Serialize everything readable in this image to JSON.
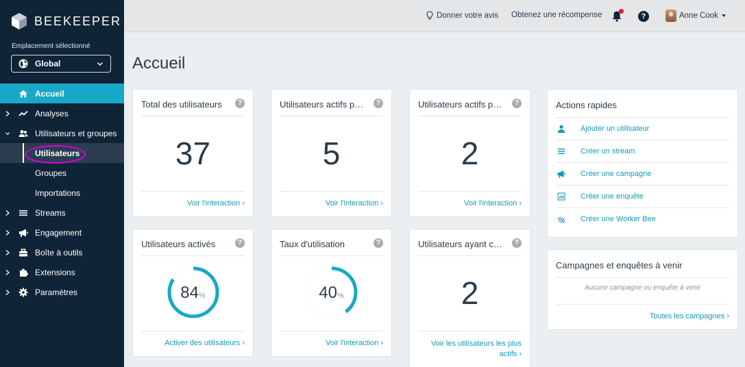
{
  "brand": {
    "name": "BEEKEEPER"
  },
  "location": {
    "label": "Emplacement sélectionné",
    "value": "Global"
  },
  "nav": {
    "home": "Accueil",
    "analytics": "Analyses",
    "users_groups": "Utilisateurs et groupes",
    "users": "Utilisateurs",
    "groups": "Groupes",
    "imports": "Importations",
    "streams": "Streams",
    "engagement": "Engagement",
    "toolbox": "Boîte à outils",
    "extensions": "Extensions",
    "settings": "Paramètres"
  },
  "topbar": {
    "feedback": "Donner votre avis",
    "reward": "Obtenez une récompense",
    "help": "?",
    "user": "Anne Cook"
  },
  "page": {
    "title": "Accueil"
  },
  "cards": {
    "total_users": {
      "title": "Total des utilisateurs",
      "value": "37",
      "link": "Voir l'interaction ›"
    },
    "active_users_1": {
      "title": "Utilisateurs actifs pa...",
      "value": "5",
      "link": "Voir l'interaction ›"
    },
    "active_users_2": {
      "title": "Utilisateurs actifs pa...",
      "value": "2",
      "link": "Voir l'interaction ›"
    },
    "activated": {
      "title": "Utilisateurs activés",
      "value": "84",
      "percent_sign": "%",
      "fraction": 0.84,
      "link": "Activer des utilisateurs ›"
    },
    "usage_rate": {
      "title": "Taux d'utilisation",
      "value": "40",
      "percent_sign": "%",
      "fraction": 0.4,
      "link": "Voir l'interaction ›"
    },
    "users_with": {
      "title": "Utilisateurs ayant co...",
      "value": "2",
      "link_line1": "Voir les utilisateurs les plus",
      "link_line2": "actifs ›"
    }
  },
  "quick_actions": {
    "title": "Actions rapides",
    "items": [
      {
        "label": "Ajouter un utilisateur",
        "icon": "user-icon"
      },
      {
        "label": "Créer un stream",
        "icon": "stream-icon"
      },
      {
        "label": "Créer une campagne",
        "icon": "megaphone-icon"
      },
      {
        "label": "Créer une enquête",
        "icon": "survey-icon"
      },
      {
        "label": "Créer une Worker Bee",
        "icon": "workerbee-icon"
      }
    ]
  },
  "campaigns": {
    "title": "Campagnes et enquêtes à venir",
    "empty": "Aucune campagne ou enquête à venir",
    "link": "Toutes les campagnes ›"
  },
  "colors": {
    "accent": "#17a9c7",
    "sidebar": "#0f2436",
    "link": "#1199b8",
    "notification": "#e3163c",
    "highlight": "#e100e1"
  }
}
